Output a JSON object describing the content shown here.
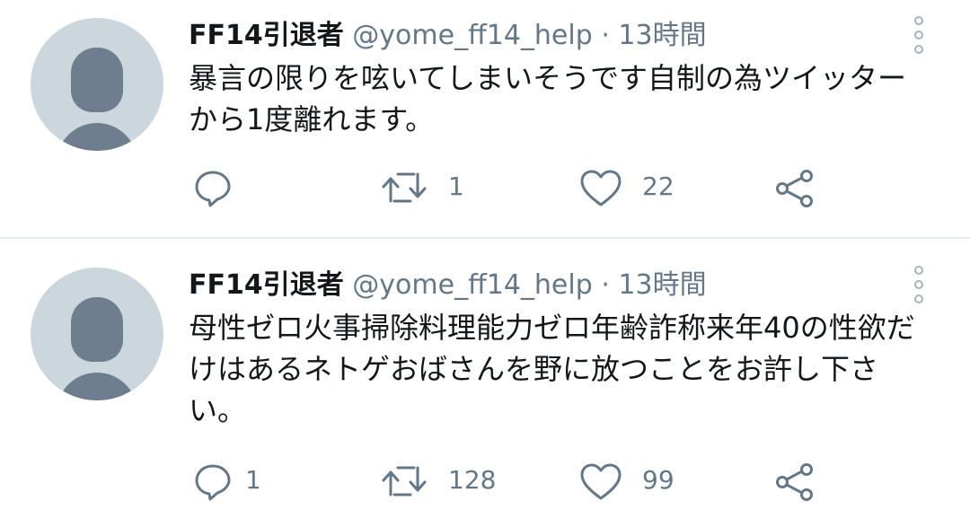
{
  "tweets": [
    {
      "display_name": "FF14引退者",
      "handle": "@yome_ff14_help",
      "separator": "·",
      "time": "13時間",
      "text": "暴言の限りを呟いてしまいそうです自制の為ツイッターから1度離れます。",
      "reply_count": "",
      "retweet_count": "1",
      "like_count": "22"
    },
    {
      "display_name": "FF14引退者",
      "handle": "@yome_ff14_help",
      "separator": "·",
      "time": "13時間",
      "text": "母性ゼロ火事掃除料理能力ゼロ年齢詐称来年40の性欲だけはあるネトゲおばさんを野に放つことをお許し下さい。",
      "reply_count": "1",
      "retweet_count": "128",
      "like_count": "99"
    }
  ],
  "icons": {
    "avatar": "default-avatar",
    "more": "vertical-dots-icon",
    "reply": "speech-bubble-icon",
    "retweet": "retweet-arrows-icon",
    "like": "heart-outline-icon",
    "share": "share-nodes-icon"
  },
  "colors": {
    "text": "#14171a",
    "muted": "#657786",
    "avatar_bg": "#ccd6dd",
    "avatar_fg": "#6e7e8f",
    "divider": "#e6ecf0"
  }
}
